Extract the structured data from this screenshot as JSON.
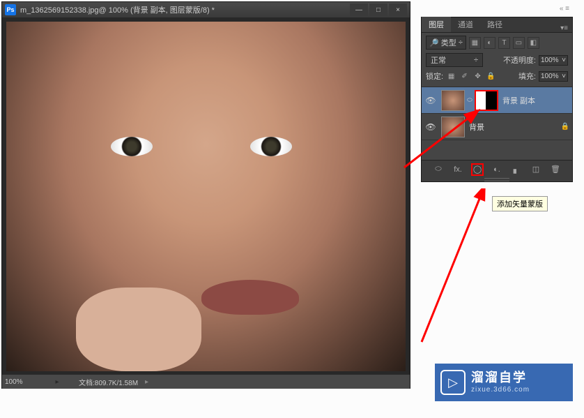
{
  "titlebar": {
    "title": "m_1362569152338.jpg@ 100% (背景 副本, 图层蒙版/8) *",
    "minimize": "—",
    "maximize": "□",
    "close": "×"
  },
  "statusbar": {
    "zoom": "100%",
    "doc_label": "文档:",
    "doc_info": "809.7K/1.58M"
  },
  "panels": {
    "tabs": {
      "layers": "图层",
      "channels": "通道",
      "paths": "路径"
    },
    "filter": {
      "type_label": "类型",
      "icons": {
        "img": "▦",
        "adj": "◐",
        "text": "T",
        "shape": "▭",
        "smart": "◧"
      }
    },
    "blend": {
      "mode": "正常",
      "opacity_label": "不透明度:",
      "opacity_value": "100%"
    },
    "lock": {
      "label": "锁定:",
      "fill_label": "填充:",
      "fill_value": "100%"
    },
    "layers_list": [
      {
        "name": "背景 副本",
        "has_mask": true,
        "locked": false,
        "active": true
      },
      {
        "name": "背景",
        "has_mask": false,
        "locked": true,
        "active": false
      }
    ],
    "bottom_icons": {
      "link": "⬭",
      "fx": "fx.",
      "mask": "◯",
      "adjust": "◐.",
      "group": "▖",
      "new": "◫",
      "trash": "🗑"
    }
  },
  "tooltip": {
    "text": "添加矢量蒙版"
  },
  "watermark": {
    "cn": "溜溜自学",
    "url": "zixue.3d66.com"
  }
}
